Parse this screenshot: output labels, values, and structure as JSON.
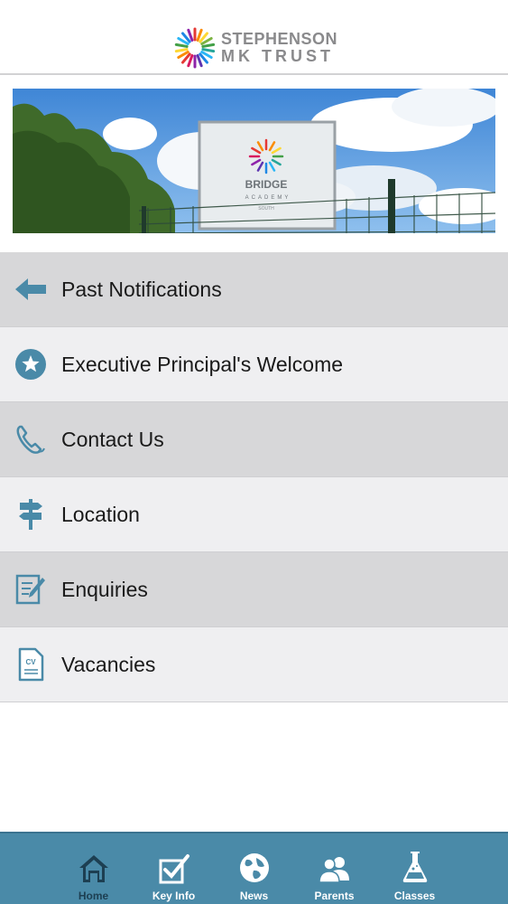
{
  "header": {
    "logo_line1": "STEPHENSON",
    "logo_line2": "MK TRUST",
    "logo_icon": "sunburst-logo-icon"
  },
  "banner": {
    "sign_title": "BRIDGE",
    "sign_subtitle": "ACADEMY",
    "sign_small": "SOUTH"
  },
  "menu": [
    {
      "label": "Past Notifications",
      "icon": "arrow-left-icon"
    },
    {
      "label": "Executive Principal's Welcome",
      "icon": "star-icon"
    },
    {
      "label": "Contact Us",
      "icon": "phone-icon"
    },
    {
      "label": "Location",
      "icon": "signpost-icon"
    },
    {
      "label": "Enquiries",
      "icon": "edit-form-icon"
    },
    {
      "label": "Vacancies",
      "icon": "cv-document-icon"
    }
  ],
  "tabbar": {
    "active": "Home",
    "tabs": [
      {
        "label": "Home",
        "icon": "home-icon"
      },
      {
        "label": "Key Info",
        "icon": "checkbox-icon"
      },
      {
        "label": "News",
        "icon": "globe-icon"
      },
      {
        "label": "Parents",
        "icon": "users-icon"
      },
      {
        "label": "Classes",
        "icon": "flask-icon"
      }
    ]
  },
  "colors": {
    "accent": "#4a8aa8",
    "row_dark": "#d7d7d9",
    "row_light": "#efeff1",
    "icon_blue": "#4a8aa8"
  }
}
